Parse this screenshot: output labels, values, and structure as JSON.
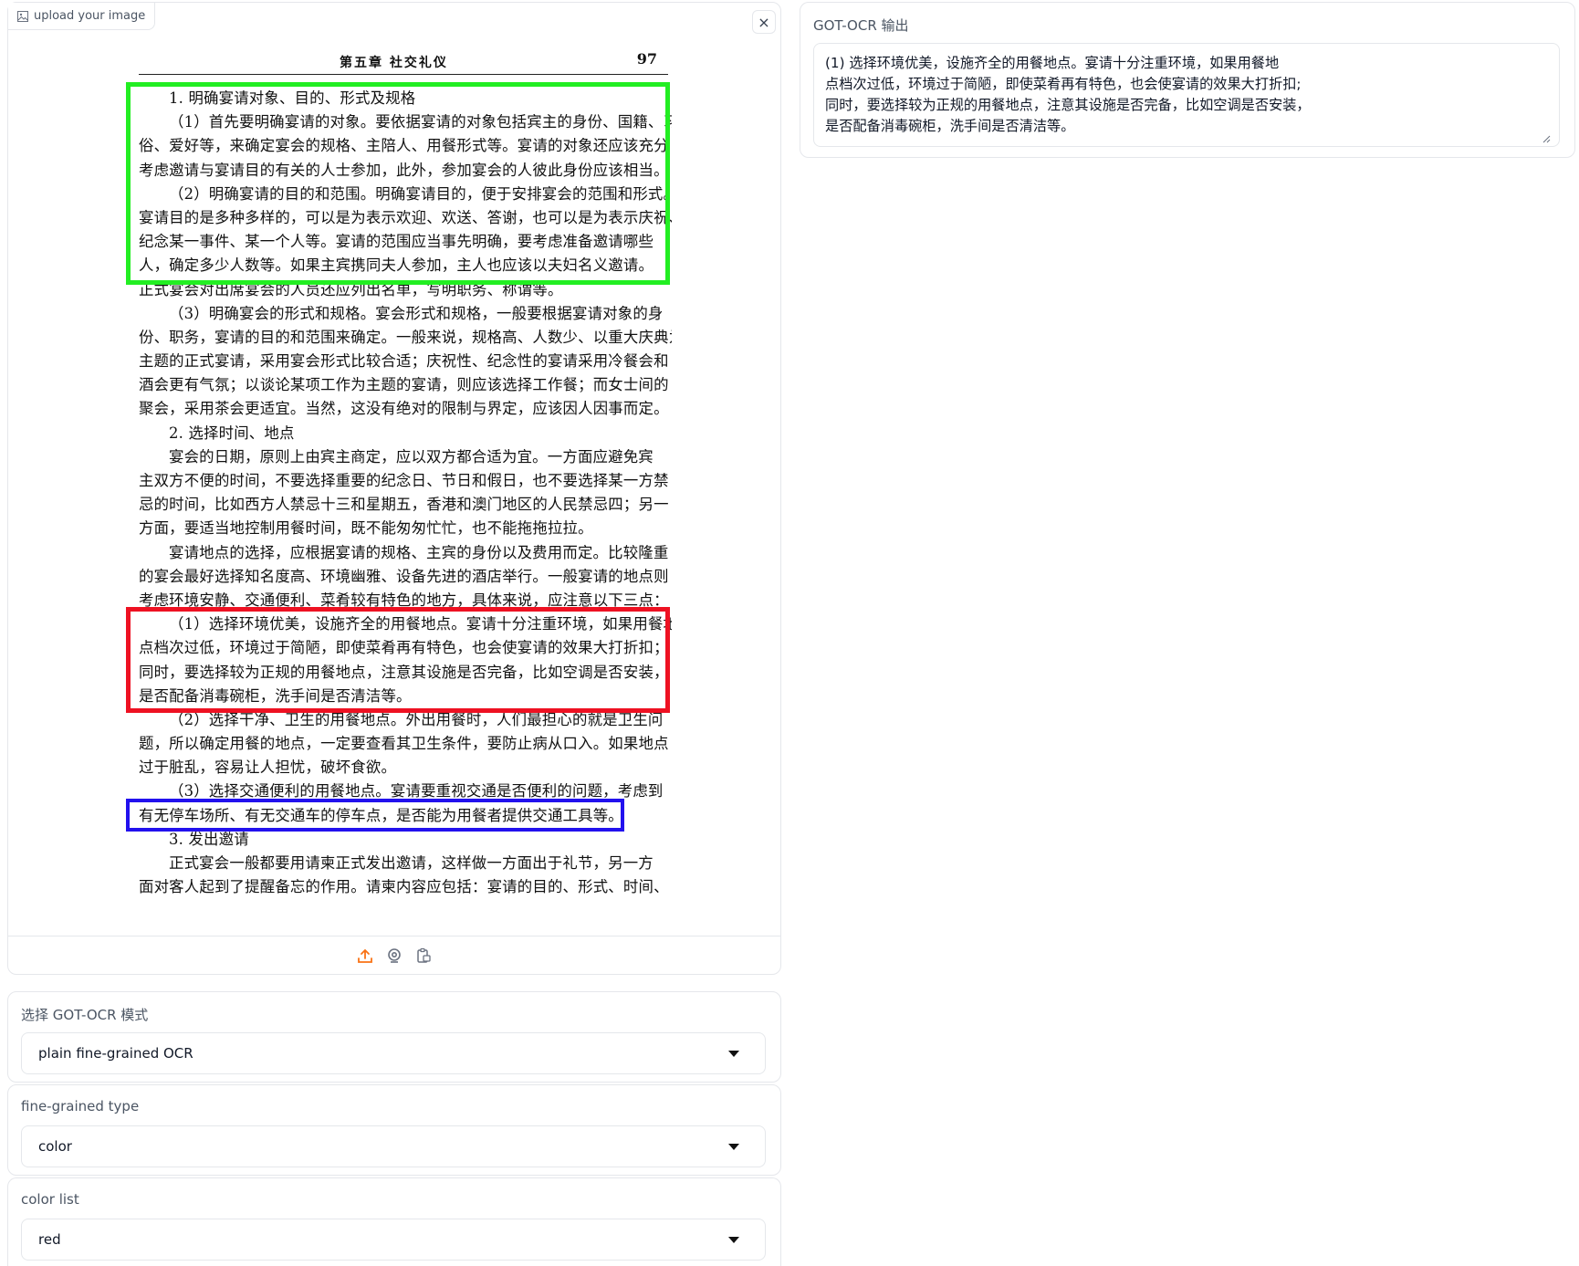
{
  "image_panel": {
    "upload_label": "upload your image",
    "close_symbol": "×"
  },
  "document": {
    "header_title": "第五章   社交礼仪",
    "page_number": "97",
    "lines": [
      {
        "text": "1. 明确宴请对象、目的、形式及规格",
        "indent": true
      },
      {
        "text": "（1）首先要明确宴请的对象。要依据宴请的对象包括宾主的身份、国籍、习",
        "indent": true
      },
      {
        "text": "俗、爱好等，来确定宴会的规格、主陪人、用餐形式等。宴请的对象还应该充分",
        "indent": false
      },
      {
        "text": "考虑邀请与宴请目的有关的人士参加，此外，参加宴会的人彼此身份应该相当。",
        "indent": false
      },
      {
        "text": "（2）明确宴请的目的和范围。明确宴请目的，便于安排宴会的范围和形式。",
        "indent": true
      },
      {
        "text": "宴请目的是多种多样的，可以是为表示欢迎、欢送、答谢，也可以是为表示庆祝、",
        "indent": false
      },
      {
        "text": "纪念某一事件、某一个人等。宴请的范围应当事先明确，要考虑准备邀请哪些",
        "indent": false
      },
      {
        "text": "人，确定多少人数等。如果主宾携同夫人参加，主人也应该以夫妇名义邀请。",
        "indent": false
      },
      {
        "text": "正式宴会对出席宴会的人员还应列出名单，写明职务、称谓等。",
        "indent": false
      },
      {
        "text": "（3）明确宴会的形式和规格。宴会形式和规格，一般要根据宴请对象的身",
        "indent": true
      },
      {
        "text": "份、职务，宴请的目的和范围来确定。一般来说，规格高、人数少、以重大庆典为",
        "indent": false
      },
      {
        "text": "主题的正式宴请，采用宴会形式比较合适；庆祝性、纪念性的宴请采用冷餐会和",
        "indent": false
      },
      {
        "text": "酒会更有气氛；以谈论某项工作为主题的宴请，则应该选择工作餐；而女士间的",
        "indent": false
      },
      {
        "text": "聚会，采用茶会更适宜。当然，这没有绝对的限制与界定，应该因人因事而定。",
        "indent": false
      },
      {
        "text": "2. 选择时间、地点",
        "indent": true
      },
      {
        "text": "宴会的日期，原则上由宾主商定，应以双方都合适为宜。一方面应避免宾",
        "indent": true
      },
      {
        "text": "主双方不便的时间，不要选择重要的纪念日、节日和假日，也不要选择某一方禁",
        "indent": false
      },
      {
        "text": "忌的时间，比如西方人禁忌十三和星期五，香港和澳门地区的人民禁忌四；另一",
        "indent": false
      },
      {
        "text": "方面，要适当地控制用餐时间，既不能匆匆忙忙，也不能拖拖拉拉。",
        "indent": false
      },
      {
        "text": "宴请地点的选择，应根据宴请的规格、主宾的身份以及费用而定。比较隆重",
        "indent": true
      },
      {
        "text": "的宴会最好选择知名度高、环境幽雅、设备先进的酒店举行。一般宴请的地点则",
        "indent": false
      },
      {
        "text": "考虑环境安静、交通便利、菜肴较有特色的地方，具体来说，应注意以下三点：",
        "indent": false
      },
      {
        "text": "（1）选择环境优美，设施齐全的用餐地点。宴请十分注重环境，如果用餐地",
        "indent": true
      },
      {
        "text": "点档次过低，环境过于简陋，即使菜肴再有特色，也会使宴请的效果大打折扣；",
        "indent": false
      },
      {
        "text": "同时，要选择较为正规的用餐地点，注意其设施是否完备，比如空调是否安装，",
        "indent": false
      },
      {
        "text": "是否配备消毒碗柜，洗手间是否清洁等。",
        "indent": false
      },
      {
        "text": "（2）选择干净、卫生的用餐地点。外出用餐时，人们最担心的就是卫生问",
        "indent": true
      },
      {
        "text": "题，所以确定用餐的地点，一定要查看其卫生条件，要防止病从口入。如果地点",
        "indent": false
      },
      {
        "text": "过于脏乱，容易让人担忧，破坏食欲。",
        "indent": false
      },
      {
        "text": "（3）选择交通便利的用餐地点。宴请要重视交通是否便利的问题，考虑到",
        "indent": true
      },
      {
        "text": "有无停车场所、有无交通车的停车点，是否能为用餐者提供交通工具等。",
        "indent": false
      },
      {
        "text": "3. 发出邀请",
        "indent": true
      },
      {
        "text": "正式宴会一般都要用请柬正式发出邀请，这样做一方面出于礼节，另一方",
        "indent": true
      },
      {
        "text": "面对客人起到了提醒备忘的作用。请柬内容应包括：宴请的目的、形式、时间、",
        "indent": false
      }
    ],
    "box_colors": {
      "green": "#22ee22",
      "red": "#ee1122",
      "blue": "#2211ee"
    }
  },
  "controls": {
    "mode": {
      "label": "选择 GOT-OCR 模式",
      "value": "plain fine-grained OCR"
    },
    "fine_type": {
      "label": "fine-grained type",
      "value": "color"
    },
    "color_list": {
      "label": "color list",
      "value": "red"
    }
  },
  "output": {
    "label": "GOT-OCR 输出",
    "text": "(1) 选择环境优美，设施齐全的用餐地点。宴请十分注重环境，如果用餐地\n点档次过低，环境过于简陋，即使菜肴再有特色，也会使宴请的效果大打折扣;\n同时，要选择较为正规的用餐地点，注意其设施是否完备，比如空调是否安装，\n是否配备消毒碗柜，洗手间是否清洁等。"
  },
  "accent_color": "#f97316"
}
